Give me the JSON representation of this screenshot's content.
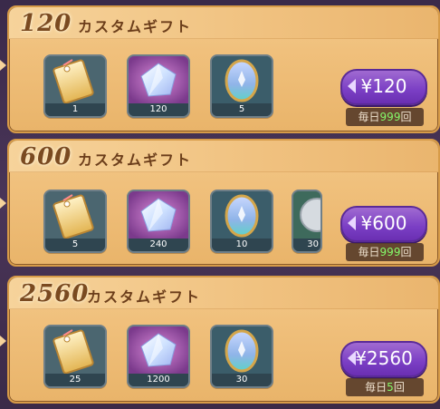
{
  "packs": [
    {
      "amount": "120",
      "title": "カスタムギフト",
      "price": "¥120",
      "limit_prefix": "毎日",
      "limit_count": "999",
      "limit_suffix": "回",
      "items": [
        {
          "icon": "ticket-icon",
          "count": "1"
        },
        {
          "icon": "crystal-icon",
          "count": "120"
        },
        {
          "icon": "egg-icon",
          "count": "5"
        }
      ]
    },
    {
      "amount": "600",
      "title": "カスタムギフト",
      "price": "¥600",
      "limit_prefix": "毎日",
      "limit_count": "999",
      "limit_suffix": "回",
      "items": [
        {
          "icon": "ticket-icon",
          "count": "5"
        },
        {
          "icon": "crystal-icon",
          "count": "240"
        },
        {
          "icon": "egg-icon",
          "count": "10"
        },
        {
          "icon": "silver-medal-icon",
          "count": "30"
        }
      ]
    },
    {
      "amount": "2560",
      "title": "カスタムギフト",
      "price": "¥2560",
      "limit_prefix": "毎日",
      "limit_count": "5",
      "limit_suffix": "回",
      "items": [
        {
          "icon": "ticket-icon",
          "count": "25"
        },
        {
          "icon": "crystal-icon",
          "count": "1200"
        },
        {
          "icon": "egg-icon",
          "count": "30"
        }
      ]
    }
  ]
}
